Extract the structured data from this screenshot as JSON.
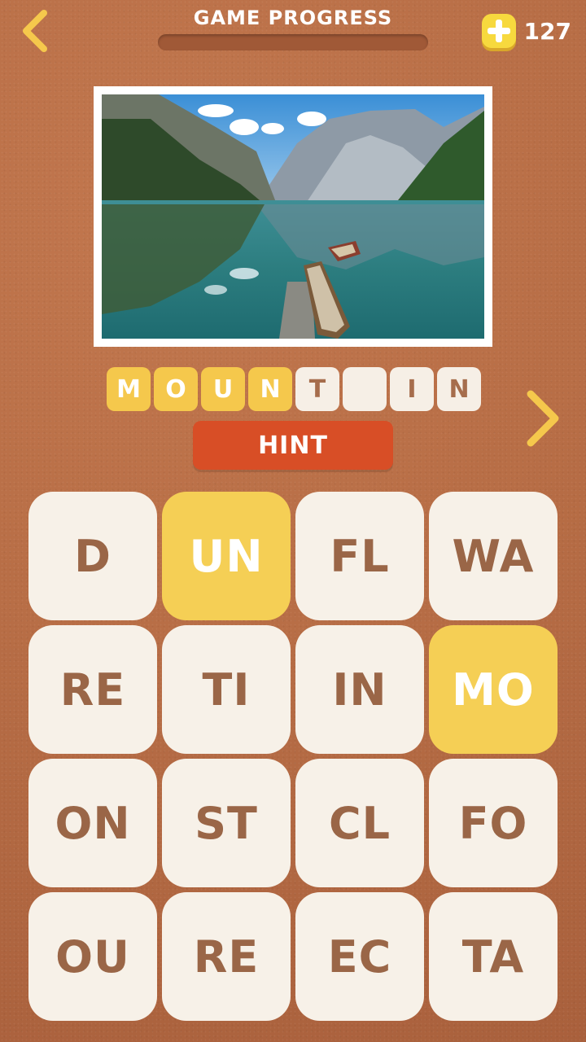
{
  "header": {
    "title": "GAME PROGRESS",
    "progress": 0,
    "coins": "127"
  },
  "colors": {
    "background": "#b86e46",
    "accent_yellow": "#f5c84c",
    "hint_red": "#d84e26",
    "tile_bg": "#f7f1e8",
    "tile_text": "#9a6647"
  },
  "icons": {
    "back": "chevron-left-icon",
    "next": "chevron-right-icon",
    "coin": "plus-coin-icon"
  },
  "answer": {
    "slots": [
      {
        "letter": "M",
        "filled": true
      },
      {
        "letter": "O",
        "filled": true
      },
      {
        "letter": "U",
        "filled": true
      },
      {
        "letter": "N",
        "filled": true
      },
      {
        "letter": "T",
        "filled": false
      },
      {
        "letter": "",
        "filled": false
      },
      {
        "letter": "I",
        "filled": false
      },
      {
        "letter": "N",
        "filled": false
      }
    ]
  },
  "hint_label": "HINT",
  "tiles": [
    {
      "text": "D",
      "selected": false
    },
    {
      "text": "UN",
      "selected": true
    },
    {
      "text": "FL",
      "selected": false
    },
    {
      "text": "WA",
      "selected": false
    },
    {
      "text": "RE",
      "selected": false
    },
    {
      "text": "TI",
      "selected": false
    },
    {
      "text": "IN",
      "selected": false
    },
    {
      "text": "MO",
      "selected": true
    },
    {
      "text": "ON",
      "selected": false
    },
    {
      "text": "ST",
      "selected": false
    },
    {
      "text": "CL",
      "selected": false
    },
    {
      "text": "FO",
      "selected": false
    },
    {
      "text": "OU",
      "selected": false
    },
    {
      "text": "RE",
      "selected": false
    },
    {
      "text": "EC",
      "selected": false
    },
    {
      "text": "TA",
      "selected": false
    }
  ]
}
